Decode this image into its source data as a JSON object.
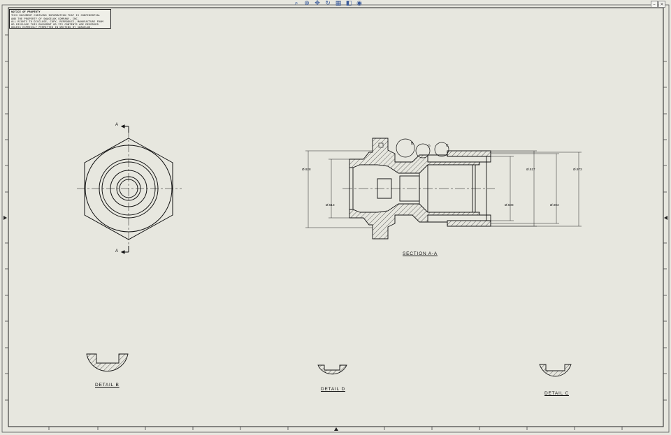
{
  "toolbar": {
    "icons": [
      "zoom-fit-icon",
      "zoom-area-icon",
      "pan-icon",
      "rotate-icon",
      "view-settings-icon",
      "display-style-icon",
      "hide-show-icon"
    ]
  },
  "window_controls": {
    "minimize": "–",
    "close": "×"
  },
  "note": {
    "header": "NOTICE OF PROPERTY",
    "lines": [
      "THIS DOCUMENT CONTAINS INFORMATION THAT IS CONFIDENTIAL",
      "AND THE PROPERTY OF SWAGELOK COMPANY, INC.",
      "ALL RIGHTS TO DISCLOSE, COPY, REPRODUCE, MANUFACTURE FROM",
      "OR DISCLOSE THIS DOCUMENT OR ITS CONTENTS ARE RESERVED",
      "UNLESS EXPRESSLY PERMITTED IN WRITING BY SWAGELOK."
    ]
  },
  "views": {
    "section_cut_label_top": "A",
    "section_cut_label_bottom": "A",
    "section_title": "SECTION A-A",
    "detail_b": "DETAIL B",
    "detail_d": "DETAIL D",
    "detail_c": "DETAIL C",
    "callout_b": "B",
    "callout_d": "D",
    "callout_c": "C"
  },
  "dimensions": {
    "d_left_outer": "Ø.928",
    "d_left_inner": "Ø.513",
    "d_right_mid": "Ø.508",
    "d_right_inner": "Ø.517",
    "d_right_outer1": "Ø.983",
    "d_right_outer2": "Ø.973"
  },
  "colors": {
    "sheet": "#e7e7df",
    "line": "#111111",
    "border": "#333333"
  }
}
